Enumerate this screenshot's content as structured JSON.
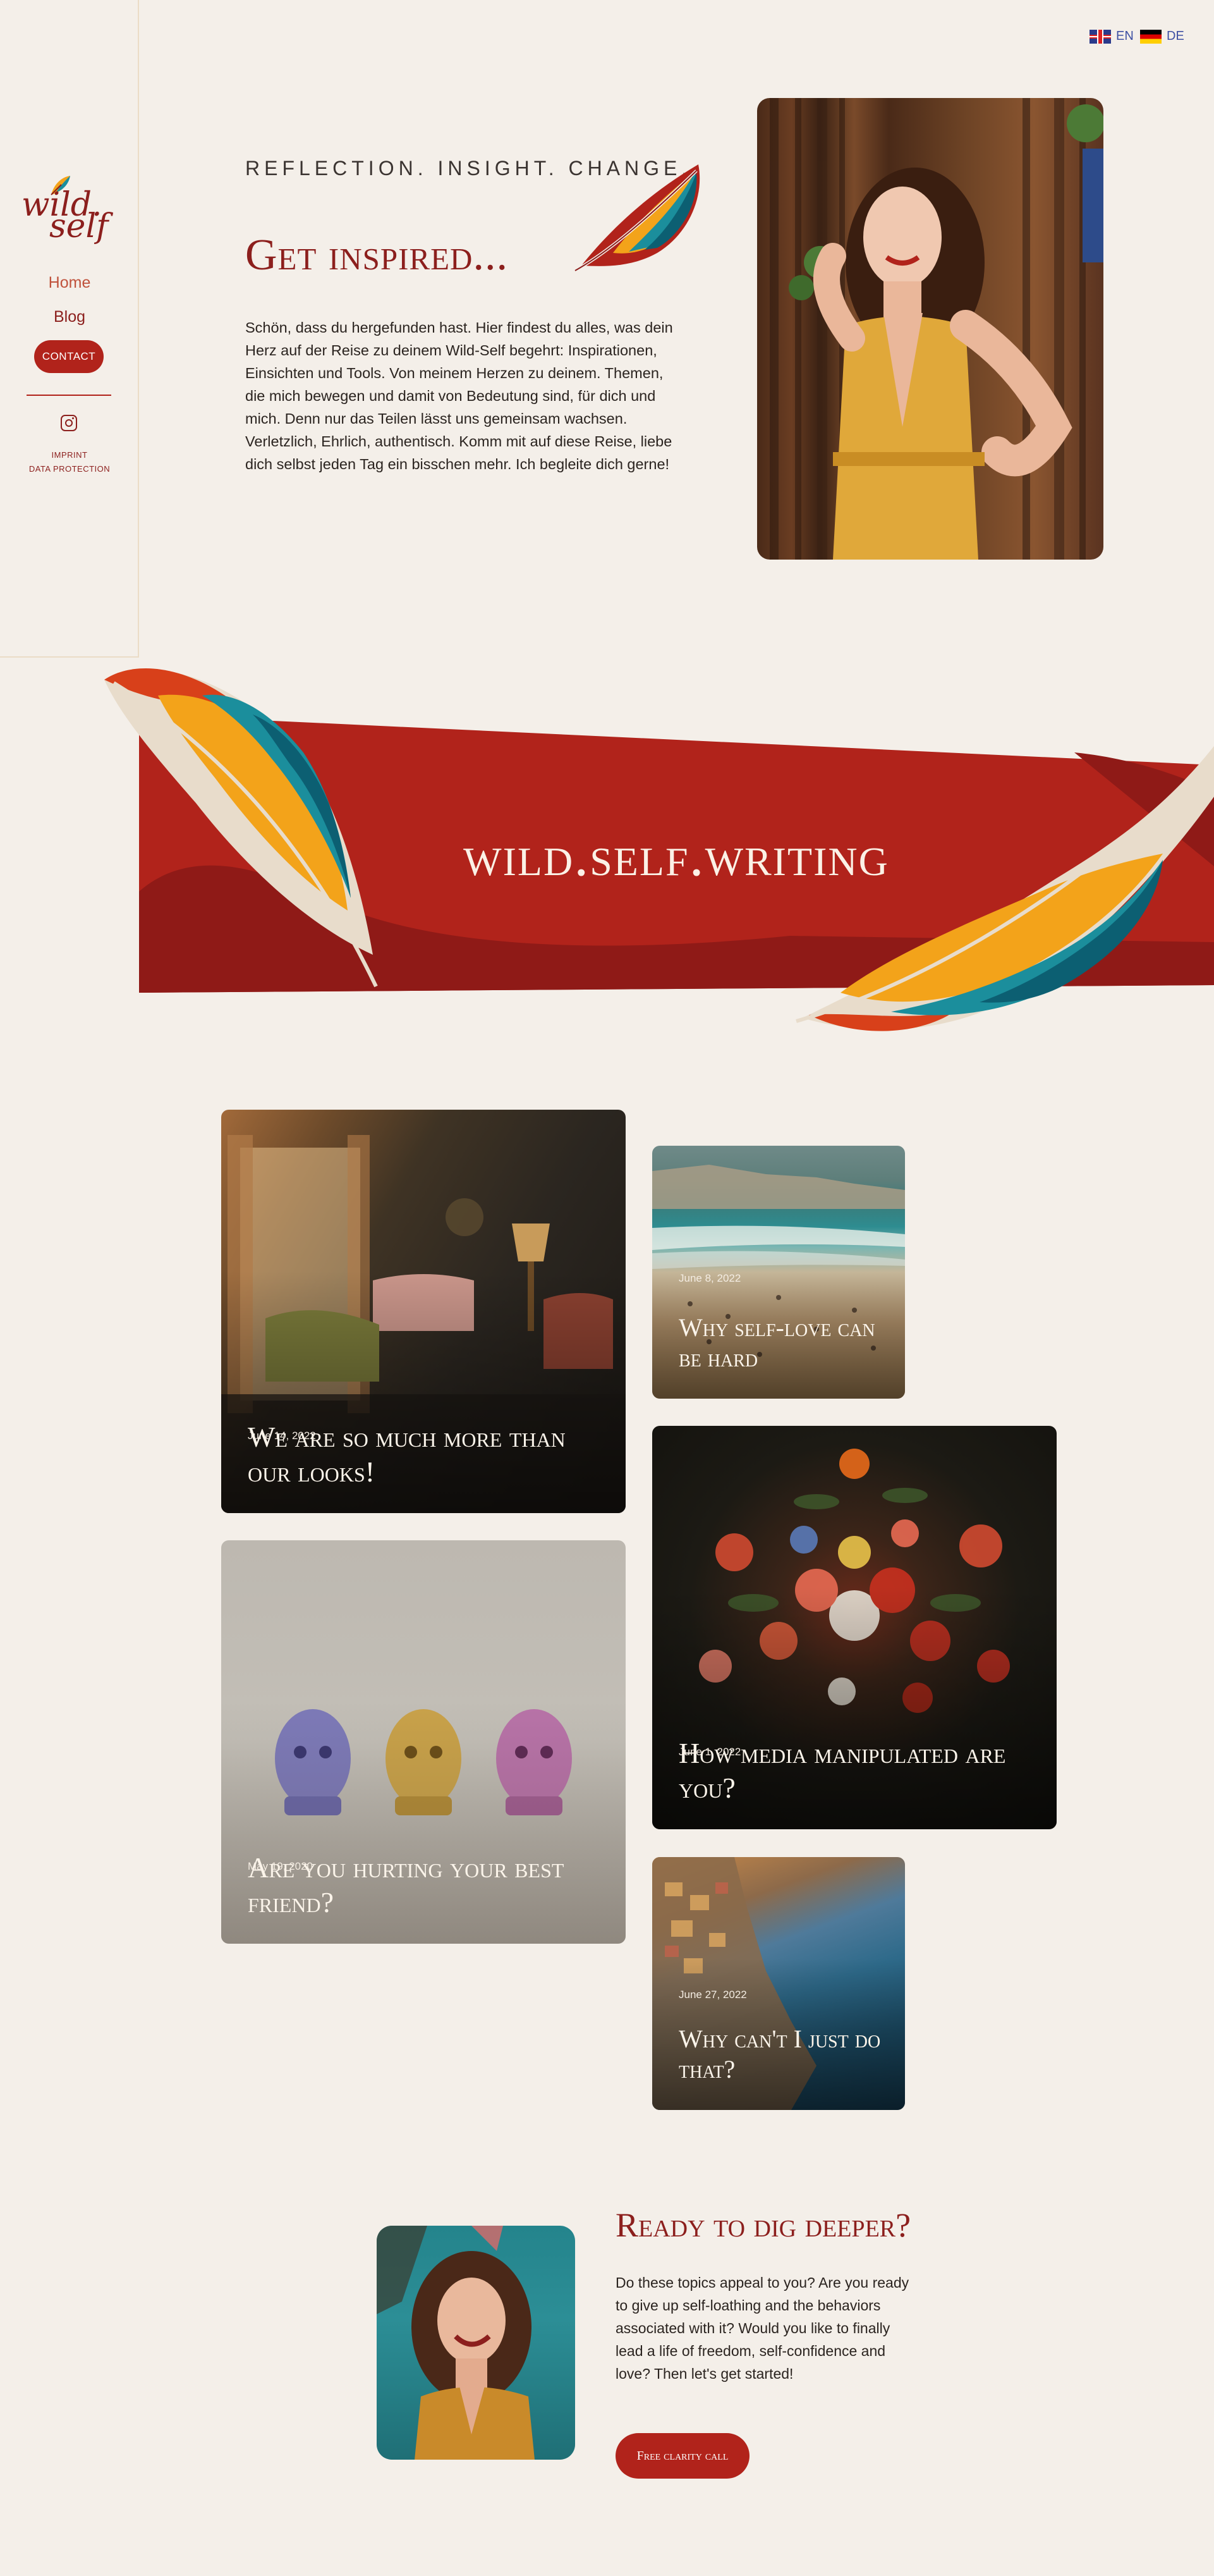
{
  "language": {
    "en_label": "EN",
    "de_label": "DE"
  },
  "sidebar": {
    "logo_line1": "wild.",
    "logo_line2": "self",
    "nav": {
      "home": "Home",
      "blog": "Blog"
    },
    "contact_label": "CONTACT",
    "imprint_label": "IMPRINT",
    "privacy_label": "DATA PROTECTION"
  },
  "hero": {
    "tagline": "REFLECTION. INSIGHT. CHANGE.",
    "title": "Get inspired...",
    "text": "Schön, dass du hergefunden hast. Hier findest du alles, was dein Herz auf der Reise zu deinem Wild-Self begehrt: Inspirationen, Einsichten und Tools. Von meinem Herzen zu deinem. Themen, die mich bewegen und damit von Bedeutung sind, für dich und mich. Denn nur das Teilen lässt uns gemeinsam wachsen. Verletzlich, Ehrlich, authentisch. Komm mit auf diese Reise, liebe dich selbst jeden Tag ein bisschen mehr. Ich begleite dich gerne!"
  },
  "banner": {
    "title": "wild.self.writing"
  },
  "posts": [
    {
      "date": "June 14, 2022",
      "title": "We are so much more than our looks!"
    },
    {
      "date": "June 8, 2022",
      "title": "Why self-love can be hard"
    },
    {
      "date": "June 1, 2022",
      "title": "How media manipulated are you?"
    },
    {
      "date": "May 19, 2020",
      "title": "Are you hurting your best friend?"
    },
    {
      "date": "June 27, 2022",
      "title": "Why can't I just do that?"
    }
  ],
  "cta": {
    "heading": "Ready to dig deeper?",
    "text": "Do these topics appeal to you? Are you ready to give up self-loathing and the behaviors associated with it? Would you like to finally lead a life of freedom, self-confidence and love? Then let's get started!",
    "button": "Free clarity call"
  },
  "colors": {
    "background": "#f4efe9",
    "brand_red": "#b1231b",
    "dark_red": "#8c1f1d",
    "feather_orange": "#f3a31a",
    "feather_teal": "#1b8e9c",
    "feather_dark_teal": "#0c5f72"
  },
  "icons": {
    "instagram": "instagram-icon",
    "flag_en": "uk-flag-icon",
    "flag_de": "german-flag-icon"
  }
}
